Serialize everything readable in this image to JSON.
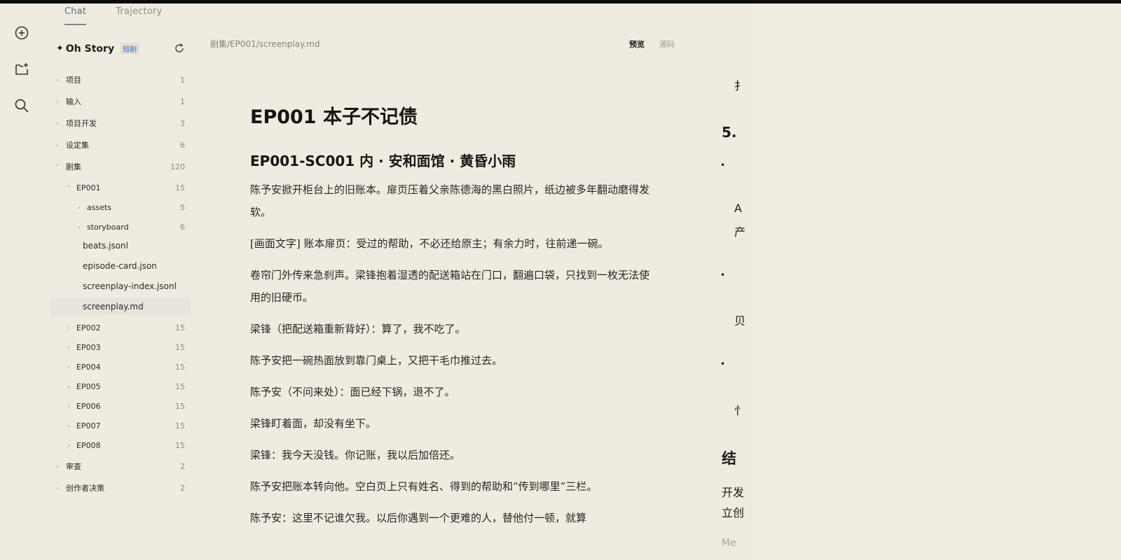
{
  "tabs": [
    {
      "label": "Chat",
      "active": true
    },
    {
      "label": "Trajectory",
      "active": false
    }
  ],
  "rail": [
    "new-chat-icon",
    "add-to-folder-icon",
    "search-icon"
  ],
  "project": {
    "name": "Oh Story",
    "badge": "短剧",
    "star": "✦"
  },
  "tree": [
    {
      "label": "项目",
      "count": "1",
      "depth": 0,
      "chev": "›"
    },
    {
      "label": "输入",
      "count": "1",
      "depth": 0,
      "chev": "›"
    },
    {
      "label": "项目开发",
      "count": "3",
      "depth": 0,
      "chev": "›"
    },
    {
      "label": "设定集",
      "count": "6",
      "depth": 0,
      "chev": "›"
    },
    {
      "label": "剧集",
      "count": "120",
      "depth": 0,
      "chev": "˅"
    },
    {
      "label": "EP001",
      "count": "15",
      "depth": 1,
      "chev": "˅"
    },
    {
      "label": "assets",
      "count": "5",
      "depth": 2,
      "chev": "›"
    },
    {
      "label": "storyboard",
      "count": "6",
      "depth": 2,
      "chev": "›"
    },
    {
      "label": "beats.jsonl",
      "count": "",
      "depth": 3,
      "chev": ""
    },
    {
      "label": "episode-card.json",
      "count": "",
      "depth": 3,
      "chev": ""
    },
    {
      "label": "screenplay-index.jsonl",
      "count": "",
      "depth": 3,
      "chev": ""
    },
    {
      "label": "screenplay.md",
      "count": "",
      "depth": 3,
      "chev": "",
      "selected": true
    },
    {
      "label": "EP002",
      "count": "15",
      "depth": 1,
      "chev": "›"
    },
    {
      "label": "EP003",
      "count": "15",
      "depth": 1,
      "chev": "›"
    },
    {
      "label": "EP004",
      "count": "15",
      "depth": 1,
      "chev": "›"
    },
    {
      "label": "EP005",
      "count": "15",
      "depth": 1,
      "chev": "›"
    },
    {
      "label": "EP006",
      "count": "15",
      "depth": 1,
      "chev": "›"
    },
    {
      "label": "EP007",
      "count": "15",
      "depth": 1,
      "chev": "›"
    },
    {
      "label": "EP008",
      "count": "15",
      "depth": 1,
      "chev": "›"
    },
    {
      "label": "审查",
      "count": "2",
      "depth": 0,
      "chev": "›"
    },
    {
      "label": "创作者决策",
      "count": "2",
      "depth": 0,
      "chev": "›"
    }
  ],
  "editor": {
    "path": "剧集/EP001/screenplay.md",
    "preview_label": "预览",
    "source_label": "源码"
  },
  "doc": {
    "title": "EP001 本子不记债",
    "scene": "EP001-SC001 内 · 安和面馆 · 黄昏小雨",
    "paragraphs": [
      "陈予安掀开柜台上的旧账本。扉页压着父亲陈德海的黑白照片，纸边被多年翻动磨得发软。",
      "[画面文字] 账本扉页：受过的帮助，不必还给原主；有余力时，往前递一碗。",
      "卷帘门外传来急刹声。梁锋抱着湿透的配送箱站在门口，翻遍口袋，只找到一枚无法使用的旧硬币。",
      "梁锋（把配送箱重新背好）：算了，我不吃了。",
      "陈予安把一碗热面放到靠门桌上，又把干毛巾推过去。",
      "陈予安（不问来处）：面已经下锅，退不了。",
      "梁锋盯着面，却没有坐下。",
      "梁锋：我今天没钱。你记账，我以后加倍还。",
      "陈予安把账本转向他。空白页上只有姓名、得到的帮助和“传到哪里”三栏。",
      "陈予安：这里不记谁欠我。以后你遇到一个更难的人，替他付一顿，就算"
    ]
  },
  "right_fragments": [
    "扌",
    "5.",
    "•",
    "A",
    "产",
    "•",
    "贝",
    "•",
    "忄",
    "结",
    "开发",
    "立创",
    "Me"
  ]
}
